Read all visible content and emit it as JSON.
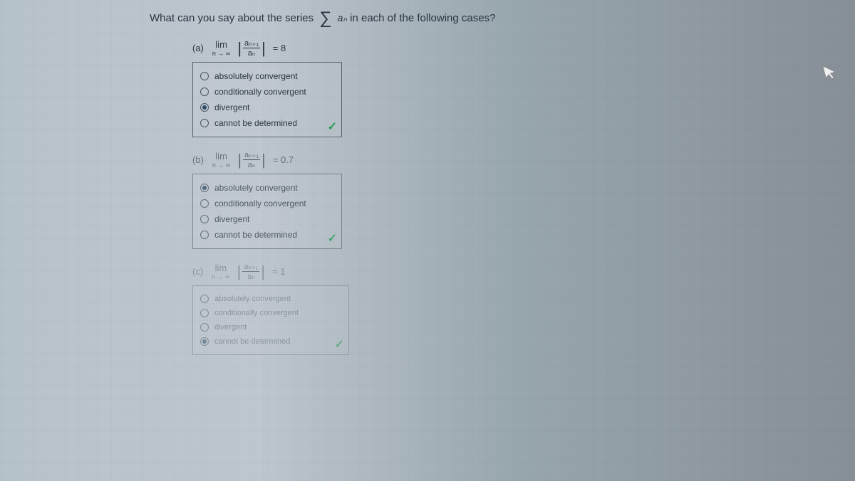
{
  "question": {
    "prefix": "What can you say about the series",
    "series_sub": "aₙ",
    "suffix": "in each of the following cases?"
  },
  "parts": [
    {
      "label": "(a)",
      "limit_top": "lim",
      "limit_bottom": "n → ∞",
      "frac_top": "aₙ₊₁",
      "frac_bot": "aₙ",
      "value": "= 8",
      "selected": 2,
      "correct": true,
      "options": [
        "absolutely convergent",
        "conditionally convergent",
        "divergent",
        "cannot be determined"
      ]
    },
    {
      "label": "(b)",
      "limit_top": "lim",
      "limit_bottom": "n → ∞",
      "frac_top": "aₙ₊₁",
      "frac_bot": "aₙ",
      "value": "= 0.7",
      "selected": 0,
      "correct": true,
      "options": [
        "absolutely convergent",
        "conditionally convergent",
        "divergent",
        "cannot be determined"
      ]
    },
    {
      "label": "(c)",
      "limit_top": "lim",
      "limit_bottom": "n → ∞",
      "frac_top": "aₙ₊₁",
      "frac_bot": "aₙ",
      "value": "= 1",
      "selected": 3,
      "correct": true,
      "options": [
        "absolutely convergent",
        "conditionally convergent",
        "divergent",
        "cannot be determined"
      ]
    }
  ]
}
